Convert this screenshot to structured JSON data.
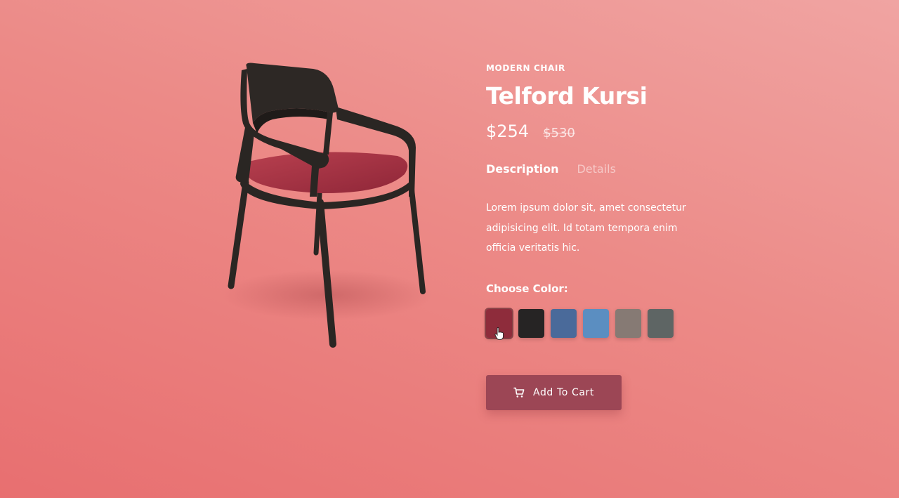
{
  "product": {
    "image_alt": "chair-image",
    "category": "MODERN CHAIR",
    "title": "Telford Kursi",
    "price": "$254",
    "old_price": "$530"
  },
  "tabs": [
    {
      "label": "Description",
      "active": true
    },
    {
      "label": "Details",
      "active": false
    }
  ],
  "description": "Lorem ipsum dolor sit, amet consectetur adipisicing elit. Id totam tempora enim officia veritatis hic.",
  "colors": {
    "label": "Choose Color:",
    "selected_index": 0,
    "swatches": [
      {
        "name": "red",
        "color": "#8e2c3b"
      },
      {
        "name": "black",
        "color": "#262424"
      },
      {
        "name": "denim",
        "color": "#4a6a9a"
      },
      {
        "name": "light-blue",
        "color": "#5b8ec1"
      },
      {
        "name": "taupe",
        "color": "#867a74"
      },
      {
        "name": "gray",
        "color": "#5e6564"
      }
    ]
  },
  "cart": {
    "icon": "cart-icon",
    "label": "Add To Cart"
  },
  "accent_colors": {
    "button": "#9c4655",
    "background": "#ec8a87"
  }
}
